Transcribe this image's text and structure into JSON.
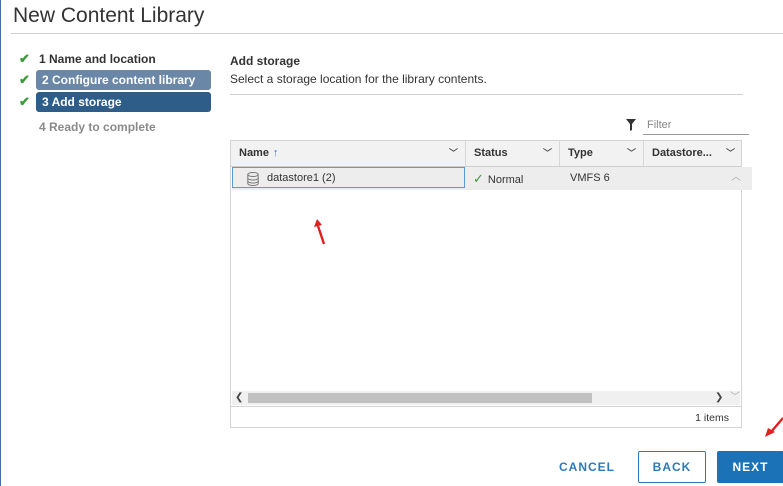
{
  "dialog": {
    "title": "New Content Library"
  },
  "steps": [
    {
      "label": "1 Name and location",
      "state": "done"
    },
    {
      "label": "2 Configure content library",
      "state": "done"
    },
    {
      "label": "3 Add storage",
      "state": "active"
    },
    {
      "label": "4 Ready to complete",
      "state": "pending"
    }
  ],
  "section": {
    "title": "Add storage",
    "description": "Select a storage location for the library contents."
  },
  "filter": {
    "placeholder": "Filter",
    "icon": "filter-icon"
  },
  "grid": {
    "columns": [
      {
        "label": "Name",
        "sort": "ascending"
      },
      {
        "label": "Status"
      },
      {
        "label": "Type"
      },
      {
        "label": "Datastore..."
      }
    ],
    "rows": [
      {
        "name": "datastore1 (2)",
        "status": "Normal",
        "type": "VMFS 6",
        "icon": "database-icon",
        "selected": true
      }
    ],
    "footer": {
      "count": "1 items"
    }
  },
  "buttons": {
    "cancel": "CANCEL",
    "back": "BACK",
    "next": "NEXT"
  },
  "colors": {
    "accent": "#1b72b6",
    "check": "#3d9a3d",
    "annotation": "#e02020",
    "active_step": "#2e5d8a"
  }
}
